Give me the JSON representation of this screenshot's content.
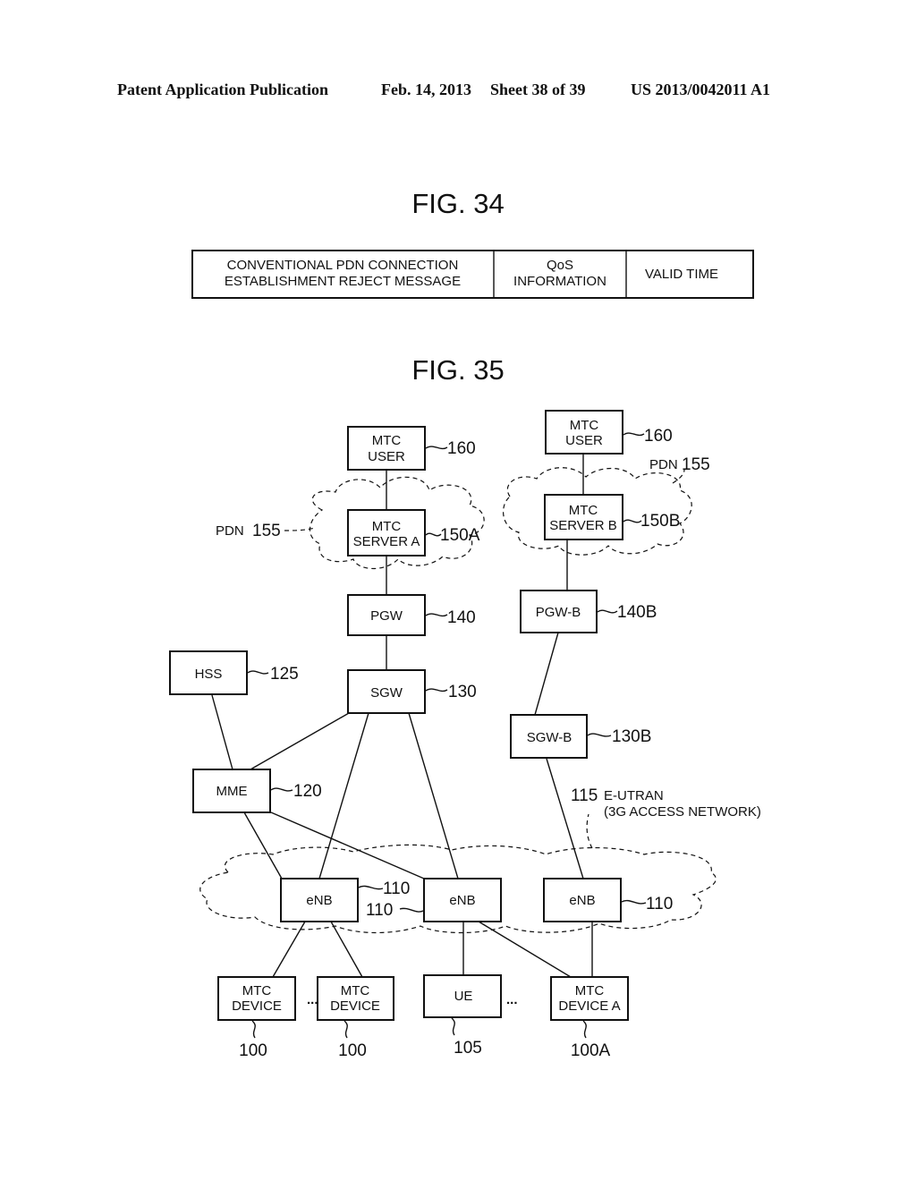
{
  "header": {
    "publication": "Patent Application Publication",
    "date": "Feb. 14, 2013",
    "sheet": "Sheet 38 of 39",
    "number": "US 2013/0042011 A1"
  },
  "fig34": {
    "title": "FIG. 34",
    "fields": [
      {
        "line1": "CONVENTIONAL PDN CONNECTION",
        "line2": "ESTABLISHMENT REJECT MESSAGE"
      },
      {
        "line1": "QoS",
        "line2": "INFORMATION"
      },
      {
        "line1": "VALID TIME",
        "line2": ""
      }
    ]
  },
  "fig35": {
    "title": "FIG. 35",
    "nodes": {
      "mtc_user_a": {
        "line1": "MTC",
        "line2": "USER",
        "ref": "160"
      },
      "mtc_user_b": {
        "line1": "MTC",
        "line2": "USER",
        "ref": "160"
      },
      "mtc_server_a": {
        "line1": "MTC",
        "line2": "SERVER A",
        "ref": "150A"
      },
      "mtc_server_b": {
        "line1": "MTC",
        "line2": "SERVER B",
        "ref": "150B"
      },
      "pgw": {
        "label": "PGW",
        "ref": "140"
      },
      "pgw_b": {
        "label": "PGW-B",
        "ref": "140B"
      },
      "hss": {
        "label": "HSS",
        "ref": "125"
      },
      "sgw": {
        "label": "SGW",
        "ref": "130"
      },
      "sgw_b": {
        "label": "SGW-B",
        "ref": "130B"
      },
      "mme": {
        "label": "MME",
        "ref": "120"
      },
      "enb_1": {
        "label": "eNB",
        "ref": "110"
      },
      "enb_2": {
        "label": "eNB",
        "ref": "110"
      },
      "enb_3": {
        "label": "eNB",
        "ref": "110"
      },
      "mtc_device_1": {
        "line1": "MTC",
        "line2": "DEVICE",
        "ref": "100"
      },
      "mtc_device_2": {
        "line1": "MTC",
        "line2": "DEVICE",
        "ref": "100"
      },
      "ue": {
        "label": "UE",
        "ref": "105"
      },
      "mtc_device_a": {
        "line1": "MTC",
        "line2": "DEVICE A",
        "ref": "100A"
      }
    },
    "pdn_a_label": "PDN",
    "pdn_a_ref": "155",
    "pdn_b_label": "PDN",
    "pdn_b_ref": "155",
    "eutran_ref": "115",
    "eutran_line1": "E-UTRAN",
    "eutran_line2": "(3G ACCESS NETWORK)",
    "ellipsis": "..."
  }
}
